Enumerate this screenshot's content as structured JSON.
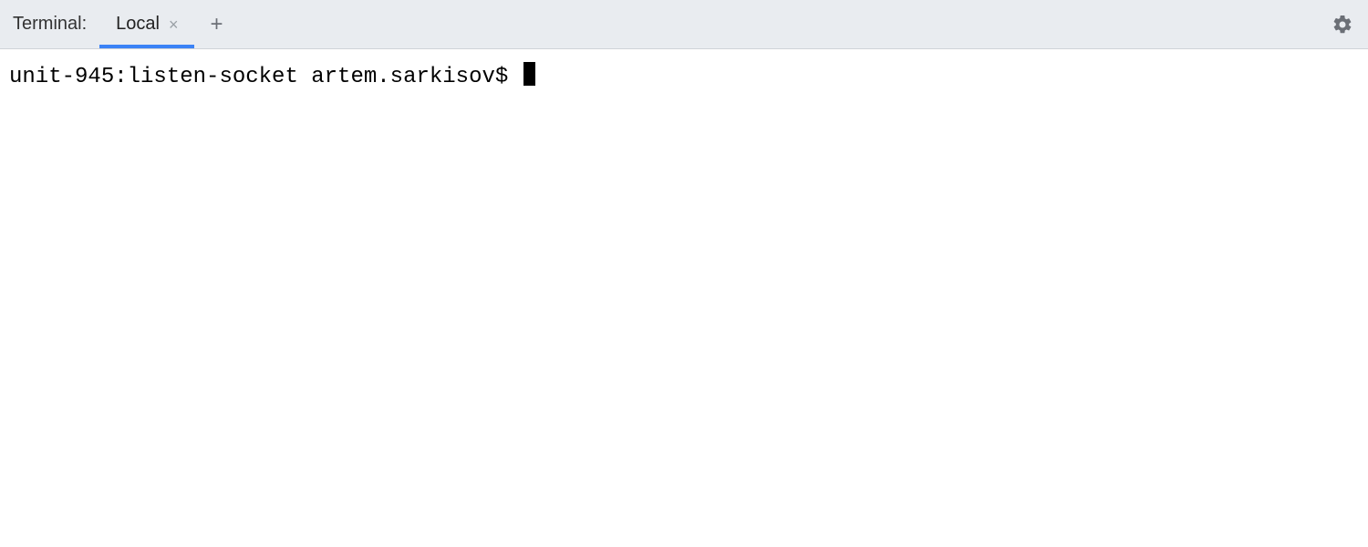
{
  "header": {
    "title": "Terminal:",
    "tabs": [
      {
        "label": "Local",
        "active": true
      }
    ]
  },
  "terminal": {
    "prompt": "unit-945:listen-socket artem.sarkisov$ "
  }
}
